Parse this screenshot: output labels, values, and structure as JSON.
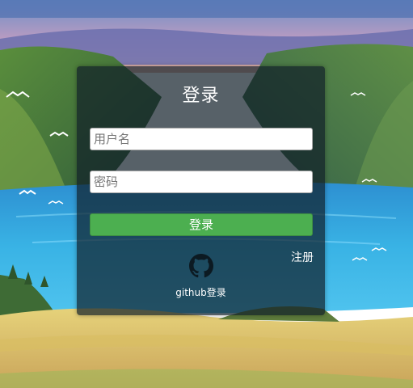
{
  "login": {
    "title": "登录",
    "username_placeholder": "用户名",
    "password_placeholder": "密码",
    "submit_label": "登录",
    "register_label": "注册",
    "github_label": "github登录",
    "github_icon": "github-icon"
  },
  "colors": {
    "submit": "#4caf50",
    "panel": "rgba(16,30,40,0.70)"
  }
}
